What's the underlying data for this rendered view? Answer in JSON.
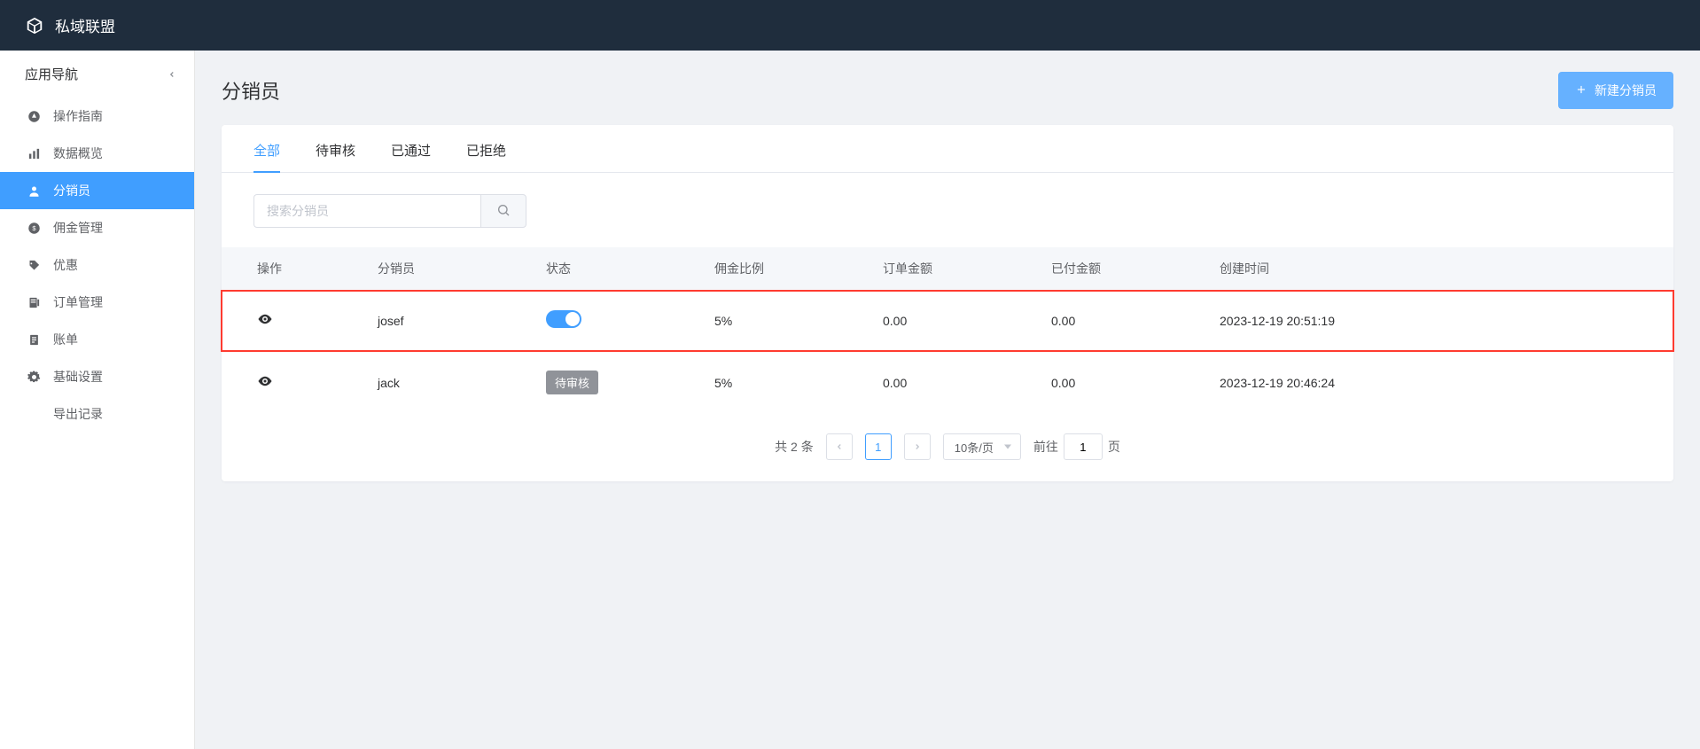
{
  "brand": {
    "title": "私域联盟"
  },
  "sidebar": {
    "title": "应用导航",
    "items": [
      {
        "label": "操作指南"
      },
      {
        "label": "数据概览"
      },
      {
        "label": "分销员"
      },
      {
        "label": "佣金管理"
      },
      {
        "label": "优惠"
      },
      {
        "label": "订单管理"
      },
      {
        "label": "账单"
      },
      {
        "label": "基础设置"
      },
      {
        "label": "导出记录"
      }
    ],
    "active_index": 2
  },
  "page": {
    "title": "分销员",
    "new_button_label": "新建分销员"
  },
  "tabs": {
    "items": [
      {
        "label": "全部"
      },
      {
        "label": "待审核"
      },
      {
        "label": "已通过"
      },
      {
        "label": "已拒绝"
      }
    ],
    "active_index": 0
  },
  "search": {
    "placeholder": "搜索分销员",
    "value": ""
  },
  "table": {
    "headers": {
      "action": "操作",
      "name": "分销员",
      "status": "状态",
      "rate": "佣金比例",
      "order_amount": "订单金额",
      "paid_amount": "已付金额",
      "created_at": "创建时间"
    },
    "rows": [
      {
        "name": "josef",
        "status_type": "toggle",
        "status_on": true,
        "rate": "5%",
        "order_amount": "0.00",
        "paid_amount": "0.00",
        "created_at": "2023-12-19 20:51:19",
        "highlighted": true
      },
      {
        "name": "jack",
        "status_type": "badge",
        "status_badge": "待审核",
        "rate": "5%",
        "order_amount": "0.00",
        "paid_amount": "0.00",
        "created_at": "2023-12-19 20:46:24",
        "highlighted": false
      }
    ]
  },
  "pagination": {
    "total_text": "共 2 条",
    "current_page": "1",
    "page_size_label": "10条/页",
    "goto_prefix": "前往",
    "goto_value": "1",
    "goto_suffix": "页"
  }
}
